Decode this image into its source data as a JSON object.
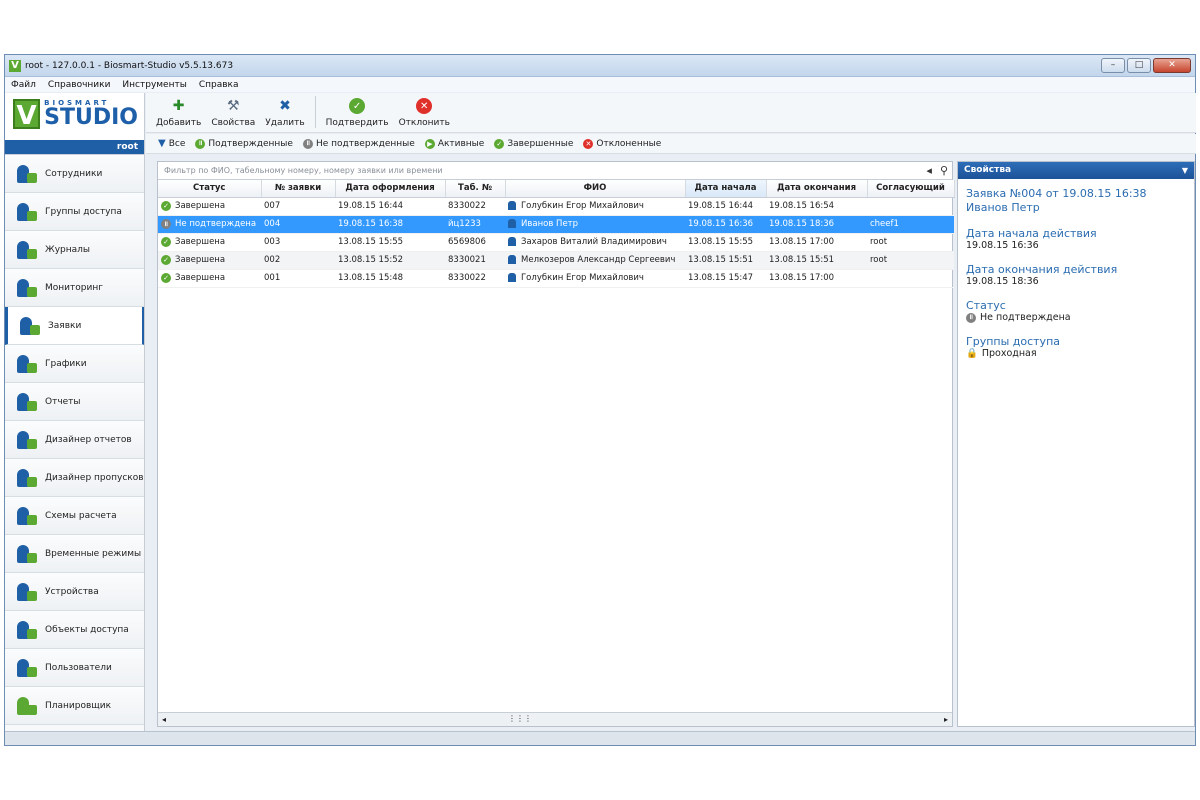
{
  "window": {
    "title": "root - 127.0.0.1 - Biosmart-Studio v5.5.13.673"
  },
  "menu": [
    "Файл",
    "Справочники",
    "Инструменты",
    "Справка"
  ],
  "logo": {
    "small": "BIOSMART",
    "big": "STUDIO",
    "user": "root"
  },
  "sidebar": {
    "items": [
      {
        "label": "Сотрудники",
        "icon": "employees-icon"
      },
      {
        "label": "Группы доступа",
        "icon": "access-groups-icon"
      },
      {
        "label": "Журналы",
        "icon": "journals-icon"
      },
      {
        "label": "Мониторинг",
        "icon": "monitoring-icon"
      },
      {
        "label": "Заявки",
        "icon": "requests-icon"
      },
      {
        "label": "Графики",
        "icon": "schedules-icon"
      },
      {
        "label": "Отчеты",
        "icon": "reports-icon"
      },
      {
        "label": "Дизайнер отчетов",
        "icon": "report-designer-icon"
      },
      {
        "label": "Дизайнер пропусков",
        "icon": "pass-designer-icon"
      },
      {
        "label": "Схемы расчета",
        "icon": "calc-schemes-icon"
      },
      {
        "label": "Временные режимы",
        "icon": "time-modes-icon"
      },
      {
        "label": "Устройства",
        "icon": "devices-icon"
      },
      {
        "label": "Объекты доступа",
        "icon": "access-objects-icon"
      },
      {
        "label": "Пользователи",
        "icon": "users-icon"
      },
      {
        "label": "Планировщик",
        "icon": "scheduler-icon"
      }
    ]
  },
  "toolbar": {
    "add": "Добавить",
    "properties": "Свойства",
    "delete": "Удалить",
    "confirm": "Подтвердить",
    "reject": "Отклонить"
  },
  "filters": {
    "all": "Все",
    "confirmed": "Подтвержденные",
    "unconfirmed": "Не подтвержденные",
    "active": "Активные",
    "completed": "Завершенные",
    "rejected": "Отклоненные"
  },
  "search": {
    "placeholder": "Фильтр по ФИО, табельному номеру, номеру заявки или времени"
  },
  "table": {
    "headers": [
      "Статус",
      "№ заявки",
      "Дата оформления",
      "Таб. №",
      "ФИО",
      "Дата начала",
      "Дата окончания",
      "Согласующий"
    ],
    "rows": [
      {
        "status": "Завершена",
        "num": "007",
        "created": "19.08.15 16:44",
        "tab": "8330022",
        "fio": "Голубкин Егор Михайлович",
        "start": "19.08.15 16:44",
        "end": "19.08.15 16:54",
        "approver": ""
      },
      {
        "status": "Не подтверждена",
        "num": "004",
        "created": "19.08.15 16:38",
        "tab": "йц1233",
        "fio": "Иванов Петр",
        "start": "19.08.15 16:36",
        "end": "19.08.15 18:36",
        "approver": "cheef1"
      },
      {
        "status": "Завершена",
        "num": "003",
        "created": "13.08.15 15:55",
        "tab": "6569806",
        "fio": "Захаров Виталий Владимирович",
        "start": "13.08.15 15:55",
        "end": "13.08.15 17:00",
        "approver": "root"
      },
      {
        "status": "Завершена",
        "num": "002",
        "created": "13.08.15 15:52",
        "tab": "8330021",
        "fio": "Мелкозеров Александр Сергеевич",
        "start": "13.08.15 15:51",
        "end": "13.08.15 15:51",
        "approver": "root"
      },
      {
        "status": "Завершена",
        "num": "001",
        "created": "13.08.15 15:48",
        "tab": "8330022",
        "fio": "Голубкин Егор Михайлович",
        "start": "13.08.15 15:47",
        "end": "13.08.15 17:00",
        "approver": ""
      }
    ]
  },
  "properties": {
    "header": "Свойства",
    "title": "Заявка №004 от 19.08.15 16:38 Иванов Петр",
    "start_label": "Дата начала действия",
    "start_value": "19.08.15 16:36",
    "end_label": "Дата окончания действия",
    "end_value": "19.08.15 18:36",
    "status_label": "Статус",
    "status_value": "Не подтверждена",
    "groups_label": "Группы доступа",
    "groups_value": "Проходная"
  },
  "colors": {
    "accent": "#1f5fa6",
    "selection": "#3399ff",
    "ok": "#5ba832",
    "reject": "#e0302a",
    "pending": "#808080"
  }
}
